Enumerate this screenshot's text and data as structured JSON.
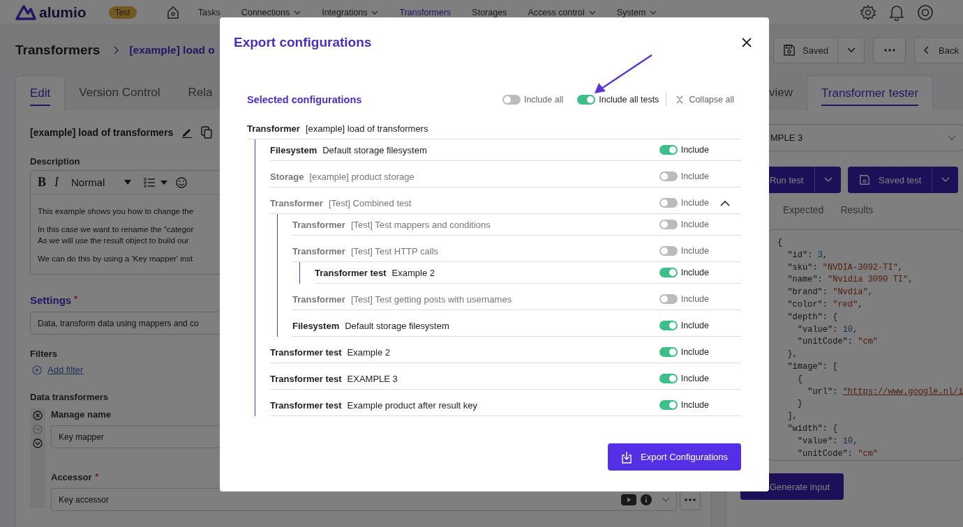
{
  "nav": {
    "logo": "alumio",
    "env_badge": "Test",
    "items": [
      {
        "label": "Tasks",
        "selected": false,
        "has_menu": false
      },
      {
        "label": "Connections",
        "selected": false,
        "has_menu": true
      },
      {
        "label": "Integrations",
        "selected": false,
        "has_menu": true
      },
      {
        "label": "Transformers",
        "selected": true,
        "has_menu": false
      },
      {
        "label": "Storages",
        "selected": false,
        "has_menu": false
      },
      {
        "label": "Access control",
        "selected": false,
        "has_menu": true
      },
      {
        "label": "System",
        "selected": false,
        "has_menu": true
      }
    ]
  },
  "header": {
    "title": "Transformers",
    "breadcrumb": "[example] load o",
    "save_button": "Saved",
    "back_button": "Back"
  },
  "editor": {
    "tabs": [
      {
        "label": "Edit",
        "selected": true
      },
      {
        "label": "Version Control",
        "selected": false
      },
      {
        "label": "Rela",
        "selected": false
      }
    ],
    "name": "[example] load of transformers",
    "description_label": "Description",
    "bold_key": "B",
    "italic_key": "I",
    "format": "Normal",
    "description_lines": [
      "This example shows you how to change the",
      "In this case we want to rename the \"categor",
      "As we will use the result object to build our",
      "We can do this by using a 'Key mapper' inst"
    ],
    "settings": {
      "label": "Settings",
      "required_mark": "*",
      "value": "Data, transform data using mappers and co"
    },
    "filters_label": "Filters",
    "add_filter": "Add filter",
    "transformers_label": "Data transformers",
    "manage_name": {
      "label": "Manage name",
      "value": "Key mapper"
    },
    "accessor": {
      "label": "Accessor",
      "required_mark": "*",
      "value": "Key accessor"
    }
  },
  "tester": {
    "tabs": [
      {
        "label": "view",
        "selected": false
      },
      {
        "label": "Transformer tester",
        "selected": true
      }
    ],
    "test_select": "MPLE 3",
    "run_button": "Run test",
    "saved_button": "Saved test",
    "result_tabs": [
      {
        "label": "Expected",
        "selected": false
      },
      {
        "label": "Results",
        "selected": false
      }
    ],
    "code": [
      [
        {
          "text": "{",
          "kind": "punct"
        }
      ],
      [
        {
          "text": "  \"id\"",
          "kind": "key"
        },
        {
          "text": ": ",
          "kind": "punct"
        },
        {
          "text": "3",
          "kind": "number"
        },
        {
          "text": ",",
          "kind": "punct"
        }
      ],
      [
        {
          "text": "  \"sku\"",
          "kind": "key"
        },
        {
          "text": ": ",
          "kind": "punct"
        },
        {
          "text": "\"NVDIA-3092-TI\"",
          "kind": "string"
        },
        {
          "text": ",",
          "kind": "punct"
        }
      ],
      [
        {
          "text": "  \"name\"",
          "kind": "key"
        },
        {
          "text": ": ",
          "kind": "punct"
        },
        {
          "text": "\"Nvidia 3090 TI\"",
          "kind": "string"
        },
        {
          "text": ",",
          "kind": "punct"
        }
      ],
      [
        {
          "text": "  \"brand\"",
          "kind": "key"
        },
        {
          "text": ": ",
          "kind": "punct"
        },
        {
          "text": "\"Nvdia\"",
          "kind": "string"
        },
        {
          "text": ",",
          "kind": "punct"
        }
      ],
      [
        {
          "text": "  \"color\"",
          "kind": "key"
        },
        {
          "text": ": ",
          "kind": "punct"
        },
        {
          "text": "\"red\"",
          "kind": "string"
        },
        {
          "text": ",",
          "kind": "punct"
        }
      ],
      [
        {
          "text": "  \"depth\"",
          "kind": "key"
        },
        {
          "text": ": {",
          "kind": "punct"
        }
      ],
      [
        {
          "text": "    \"value\"",
          "kind": "key"
        },
        {
          "text": ": ",
          "kind": "punct"
        },
        {
          "text": "10",
          "kind": "number"
        },
        {
          "text": ",",
          "kind": "punct"
        }
      ],
      [
        {
          "text": "    \"unitCode\"",
          "kind": "key"
        },
        {
          "text": ": ",
          "kind": "punct"
        },
        {
          "text": "\"cm\"",
          "kind": "string"
        }
      ],
      [
        {
          "text": "  },",
          "kind": "punct"
        }
      ],
      [
        {
          "text": "  \"image\"",
          "kind": "key"
        },
        {
          "text": ": [",
          "kind": "punct"
        }
      ],
      [
        {
          "text": "    {",
          "kind": "punct"
        }
      ],
      [
        {
          "text": "      \"url\"",
          "kind": "key"
        },
        {
          "text": ": ",
          "kind": "punct"
        },
        {
          "text": "\"https://www.google.nl/i",
          "kind": "link"
        }
      ],
      [
        {
          "text": "    }",
          "kind": "punct"
        }
      ],
      [
        {
          "text": "  ],",
          "kind": "punct"
        }
      ],
      [
        {
          "text": "  \"width\"",
          "kind": "key"
        },
        {
          "text": ": {",
          "kind": "punct"
        }
      ],
      [
        {
          "text": "    \"value\"",
          "kind": "key"
        },
        {
          "text": ": ",
          "kind": "punct"
        },
        {
          "text": "10",
          "kind": "number"
        },
        {
          "text": ",",
          "kind": "punct"
        }
      ],
      [
        {
          "text": "    \"unitCode\"",
          "kind": "key"
        },
        {
          "text": ": ",
          "kind": "punct"
        },
        {
          "text": "\"cm\"",
          "kind": "string"
        }
      ]
    ],
    "generate_button": "Generate input"
  },
  "modal": {
    "title": "Export configurations",
    "section_title": "Selected configurations",
    "include_all": {
      "label": "Include all",
      "on": false
    },
    "include_all_tests": {
      "label": "Include all tests",
      "on": true
    },
    "collapse_all": "Collapse all",
    "tree": {
      "type": "Transformer",
      "name": "[example] load of transformers",
      "children": [
        {
          "type": "Filesystem",
          "name": "Default storage filesystem",
          "include": "Include",
          "on": true
        },
        {
          "type": "Storage",
          "name": "[example] product storage",
          "include": "Include",
          "on": false
        },
        {
          "type": "Transformer",
          "name": "[Test] Combined test",
          "include": "Include",
          "on": false,
          "expanded": true,
          "children": [
            {
              "type": "Transformer",
              "name": "[Test] Test mappers and conditions",
              "include": "Include",
              "on": false
            },
            {
              "type": "Transformer",
              "name": "[Test] Test HTTP calls",
              "include": "Include",
              "on": false,
              "children": [
                {
                  "type": "Transformer test",
                  "name": "Example 2",
                  "include": "Include",
                  "on": true
                }
              ]
            },
            {
              "type": "Transformer",
              "name": "[Test] Test getting posts with usernames",
              "include": "Include",
              "on": false
            },
            {
              "type": "Filesystem",
              "name": "Default storage filesystem",
              "include": "Include",
              "on": true
            }
          ]
        },
        {
          "type": "Transformer test",
          "name": "Example 2",
          "include": "Include",
          "on": true
        },
        {
          "type": "Transformer test",
          "name": "EXAMPLE 3",
          "include": "Include",
          "on": true
        },
        {
          "type": "Transformer test",
          "name": "Example product after result key",
          "include": "Include",
          "on": true
        }
      ]
    },
    "export_button": "Export Configurations"
  }
}
